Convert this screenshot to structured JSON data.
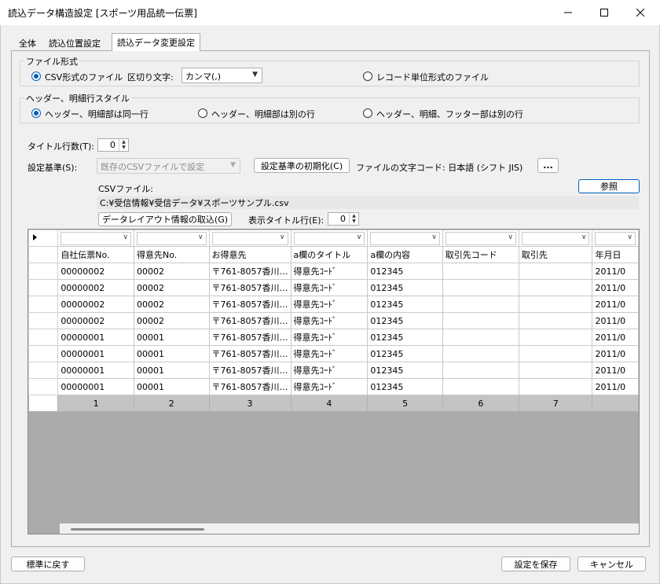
{
  "window": {
    "title": "読込データ構造設定 [スポーツ用品統一伝票]",
    "minimize_icon": "minimize-icon",
    "maximize_icon": "maximize-icon",
    "close_icon": "close-icon"
  },
  "tabs": [
    {
      "label": "全体",
      "active": false
    },
    {
      "label": "読込位置設定",
      "active": false
    },
    {
      "label": "読込データ変更設定",
      "active": true
    }
  ],
  "file_format": {
    "group_label": "ファイル形式",
    "csv_label": "CSV形式のファイル",
    "csv_checked": true,
    "delimiter_label": "区切り文字:",
    "delimiter_value": "カンマ(,)",
    "record_label": "レコード単位形式のファイル",
    "record_checked": false
  },
  "header_style": {
    "group_label": "ヘッダー、明細行スタイル",
    "options": [
      {
        "label": "ヘッダー、明細部は同一行",
        "checked": true
      },
      {
        "label": "ヘッダー、明細部は別の行",
        "checked": false
      },
      {
        "label": "ヘッダー、明細、フッター部は別の行",
        "checked": false
      }
    ]
  },
  "title_rows": {
    "label": "タイトル行数(T):",
    "value": "0"
  },
  "setting_basis": {
    "label": "設定基準(S):",
    "value": "既存のCSVファイルで設定",
    "reset_button": "設定基準の初期化(C)",
    "encoding_label": "ファイルの文字コード: 日本語 (シフト JIS)",
    "more_button": "..."
  },
  "csv_file": {
    "label": "CSVファイル:",
    "browse_button": "参照",
    "path": "C:¥受信情報¥受信データ¥スポーツサンプル.csv"
  },
  "layout_import_button": "データレイアウト情報の取込(G)",
  "display_title_row": {
    "label": "表示タイトル行(E):",
    "value": "0"
  },
  "grid": {
    "row_marker_icon": "row-pointer-icon",
    "headers": [
      "自社伝票No.",
      "得意先No.",
      "お得意先",
      "a欄のタイトル",
      "a欄の内容",
      "取引先コード",
      "取引先",
      "年月日"
    ],
    "rows": [
      [
        "00000002",
        "00002",
        "〒761-8057香川…",
        "得意先ｺｰﾄﾞ",
        "012345",
        "",
        "",
        "2011/0"
      ],
      [
        "00000002",
        "00002",
        "〒761-8057香川…",
        "得意先ｺｰﾄﾞ",
        "012345",
        "",
        "",
        "2011/0"
      ],
      [
        "00000002",
        "00002",
        "〒761-8057香川…",
        "得意先ｺｰﾄﾞ",
        "012345",
        "",
        "",
        "2011/0"
      ],
      [
        "00000002",
        "00002",
        "〒761-8057香川…",
        "得意先ｺｰﾄﾞ",
        "012345",
        "",
        "",
        "2011/0"
      ],
      [
        "00000001",
        "00001",
        "〒761-8057香川…",
        "得意先ｺｰﾄﾞ",
        "012345",
        "",
        "",
        "2011/0"
      ],
      [
        "00000001",
        "00001",
        "〒761-8057香川…",
        "得意先ｺｰﾄﾞ",
        "012345",
        "",
        "",
        "2011/0"
      ],
      [
        "00000001",
        "00001",
        "〒761-8057香川…",
        "得意先ｺｰﾄﾞ",
        "012345",
        "",
        "",
        "2011/0"
      ],
      [
        "00000001",
        "00001",
        "〒761-8057香川…",
        "得意先ｺｰﾄﾞ",
        "012345",
        "",
        "",
        "2011/0"
      ]
    ],
    "column_numbers": [
      "1",
      "2",
      "3",
      "4",
      "5",
      "6",
      "7",
      ""
    ]
  },
  "footer": {
    "reset_button": "標準に戻す",
    "save_button": "設定を保存",
    "cancel_button": "キャンセル"
  },
  "colors": {
    "accent": "#005fb8",
    "grid_empty": "#ababab",
    "column_number_bg": "#c4c4c4"
  }
}
